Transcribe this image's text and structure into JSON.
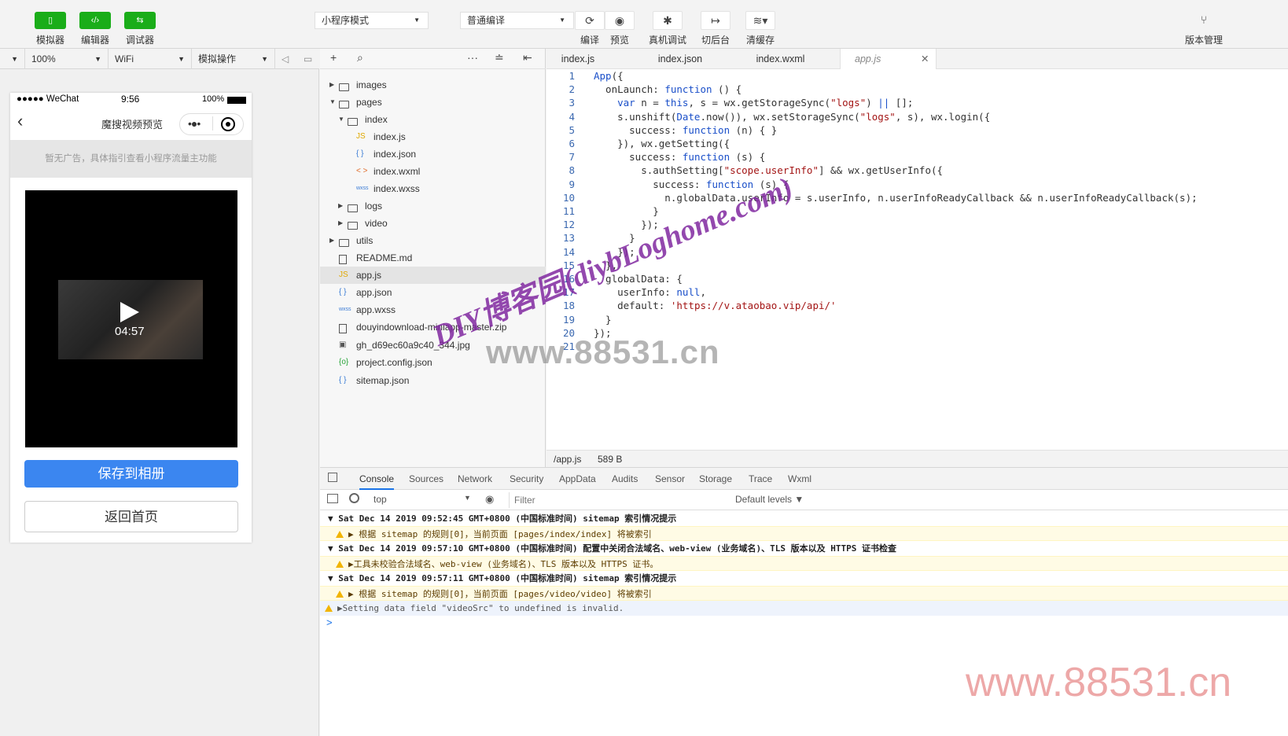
{
  "toolbar": {
    "simulator": "模拟器",
    "editor": "编辑器",
    "debugger": "调试器",
    "mode_select": "小程序模式",
    "compile_select": "普通编译",
    "compile": "编译",
    "preview": "预览",
    "remote_debug": "真机调试",
    "background": "切后台",
    "clear_cache": "清缓存",
    "version_mgmt": "版本管理"
  },
  "simbar": {
    "zoom": "100%",
    "network": "WiFi",
    "sim_ops": "模拟操作"
  },
  "phone": {
    "signal": "●●●●● WeChat",
    "time": "9:56",
    "battery": "100%",
    "nav_title": "魔搜视频预览",
    "ad_text": "暂无广告，具体指引查看小程序流量主功能",
    "duration": "04:57",
    "save_button": "保存到相册",
    "home_button": "返回首页"
  },
  "explorer": {
    "items": [
      {
        "name": "images",
        "type": "folder",
        "open": false
      },
      {
        "name": "pages",
        "type": "folder",
        "open": true
      },
      {
        "name": "index",
        "type": "folder",
        "open": true
      },
      {
        "name": "index.js",
        "type": "js"
      },
      {
        "name": "index.json",
        "type": "json"
      },
      {
        "name": "index.wxml",
        "type": "wxml"
      },
      {
        "name": "index.wxss",
        "type": "wxss"
      },
      {
        "name": "logs",
        "type": "folder",
        "open": false
      },
      {
        "name": "video",
        "type": "folder",
        "open": false
      },
      {
        "name": "utils",
        "type": "folder",
        "open": false
      },
      {
        "name": "README.md",
        "type": "file"
      },
      {
        "name": "app.js",
        "type": "js"
      },
      {
        "name": "app.json",
        "type": "json"
      },
      {
        "name": "app.wxss",
        "type": "wxss"
      },
      {
        "name": "douyindownload-miniapp-master.zip",
        "type": "file"
      },
      {
        "name": "gh_d69ec60a9c40_344.jpg",
        "type": "image"
      },
      {
        "name": "project.config.json",
        "type": "config"
      },
      {
        "name": "sitemap.json",
        "type": "json"
      }
    ]
  },
  "editor": {
    "tabs": [
      "index.js",
      "index.json",
      "index.wxml",
      "app.js"
    ],
    "status_path": "/app.js",
    "status_size": "589 B",
    "lines": [
      {
        "n": "1",
        "t": "App({"
      },
      {
        "n": "2",
        "t": "  onLaunch: function () {"
      },
      {
        "n": "3",
        "t": "    var n = this, s = wx.getStorageSync(\"logs\") || [];"
      },
      {
        "n": "4",
        "t": "    s.unshift(Date.now()), wx.setStorageSync(\"logs\", s), wx.login({"
      },
      {
        "n": "5",
        "t": "      success: function (n) { }"
      },
      {
        "n": "6",
        "t": "    }), wx.getSetting({"
      },
      {
        "n": "7",
        "t": "      success: function (s) {"
      },
      {
        "n": "8",
        "t": "        s.authSetting[\"scope.userInfo\"] && wx.getUserInfo({"
      },
      {
        "n": "9",
        "t": "          success: function (s) {"
      },
      {
        "n": "10",
        "t": "            n.globalData.userInfo = s.userInfo, n.userInfoReadyCallback && n.userInfoReadyCallback(s);"
      },
      {
        "n": "11",
        "t": "          }"
      },
      {
        "n": "12",
        "t": "        });"
      },
      {
        "n": "13",
        "t": "      }"
      },
      {
        "n": "14",
        "t": "    });"
      },
      {
        "n": "15",
        "t": "  },"
      },
      {
        "n": "16",
        "t": "  globalData: {"
      },
      {
        "n": "17",
        "t": "    userInfo: null,"
      },
      {
        "n": "18",
        "t": "    default: 'https://v.ataobao.vip/api/'"
      },
      {
        "n": "19",
        "t": "  }"
      },
      {
        "n": "20",
        "t": "});"
      },
      {
        "n": "21",
        "t": ""
      }
    ]
  },
  "devtools": {
    "tabs": [
      "Console",
      "Sources",
      "Network",
      "Security",
      "AppData",
      "Audits",
      "Sensor",
      "Storage",
      "Trace",
      "Wxml"
    ],
    "context": "top",
    "filter_placeholder": "Filter",
    "levels": "Default levels ▼",
    "logs": [
      {
        "kind": "group",
        "text": "▼ Sat Dec 14 2019 09:52:45 GMT+0800 (中国标准时间) sitemap 索引情况提示"
      },
      {
        "kind": "warn",
        "text": "▶ 根据 sitemap 的规则[0]，当前页面 [pages/index/index] 将被索引"
      },
      {
        "kind": "group",
        "text": "▼ Sat Dec 14 2019 09:57:10 GMT+0800 (中国标准时间) 配置中关闭合法域名、web-view (业务域名)、TLS 版本以及 HTTPS 证书检查"
      },
      {
        "kind": "warn",
        "text": "▶工具未校验合法域名、web-view (业务域名)、TLS 版本以及 HTTPS 证书。"
      },
      {
        "kind": "group",
        "text": "▼ Sat Dec 14 2019 09:57:11 GMT+0800 (中国标准时间) sitemap 索引情况提示"
      },
      {
        "kind": "warn",
        "text": "▶ 根据 sitemap 的规则[0]，当前页面 [pages/video/video] 将被索引"
      },
      {
        "kind": "blue",
        "text": "▶Setting data field \"videoSrc\" to undefined is invalid."
      }
    ],
    "prompt": ">"
  },
  "watermarks": {
    "gray": "www.88531.cn",
    "purple": "DIY博客园(diybLoghome.com)",
    "red": "www.88531.cn"
  }
}
